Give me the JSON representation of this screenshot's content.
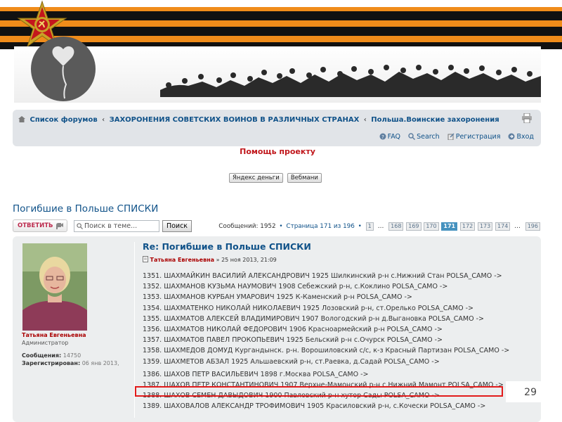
{
  "breadcrumb": {
    "items": [
      "Список форумов",
      "ЗАХОРОНЕНИЯ СОВЕТСКИХ ВОИНОВ В РАЗЛИЧНЫХ СТРАНАХ",
      "Польша.Воинские захоронения"
    ],
    "separator": "‹"
  },
  "nav": {
    "faq": "FAQ",
    "search": "Search",
    "register": "Регистрация",
    "login": "Вход"
  },
  "donate": {
    "title": "Помощь проекту",
    "buttons": [
      "Яндекс деньги",
      "Вебмани"
    ]
  },
  "topic": {
    "title": "Погибшие в Польше СПИСКИ",
    "reply_label": "ОТВЕТИТЬ",
    "search_placeholder": "Поиск в теме...",
    "search_button": "Поиск",
    "pagination": {
      "summary": "Сообщений: 1952",
      "page_info": "Страница 171 из 196",
      "pages": [
        "1",
        "168",
        "169",
        "170",
        "171",
        "172",
        "173",
        "174",
        "196"
      ],
      "current": "171"
    }
  },
  "post": {
    "author": {
      "name": "Татьяна Евгеньевна",
      "rank": "Администратор",
      "messages_label": "Сообщения:",
      "messages_value": "14750",
      "registered_label": "Зарегистрирован:",
      "registered_value": "06 янв 2013,"
    },
    "title": "Re: Погибшие в Польше СПИСКИ",
    "meta_author": "Татьяна Евгеньевна",
    "meta_date": "» 25 ноя 2013, 21:09",
    "lines": [
      "1351. ШАХМАЙКИН ВАСИЛИЙ АЛЕКСАНДРОВИЧ 1925 Шилкинский р-н с.Нижний Стан POLSA_CAMO ->",
      "1352. ШАХМАНОВ КУЗЬМА НАУМОВИЧ 1908 Себежский р-н, с.Коклино POLSA_CAMO ->",
      "1353. ШАХМАНОВ КУРБАН УМАРОВИЧ 1925 К-Каменский р-н POLSA_CAMO ->",
      "1354. ШАХМАТЕНКО НИКОЛАЙ НИКОЛАЕВИЧ 1925 Лозовский р-н, ст.Орелько POLSA_CAMO ->",
      "1355. ШАХМАТОВ АЛЕКСЕЙ ВЛАДИМИРОВИЧ 1907 Вологодский р-н д.Выгановка POLSA_CAMO ->",
      "1356. ШАХМАТОВ НИКОЛАЙ ФЕДОРОВИЧ 1906 Красноармейский р-н POLSA_CAMO ->",
      "1357. ШАХМАТОВ ПАВЕЛ ПРОКОПЬЕВИЧ 1925 Бельский р-н с.Очурск POLSA_CAMO ->",
      "1358. ШАХМЕДОВ ДОМУД Кургандынск. р-н. Ворошиловский с/с, к-з Красный Партизан POLSA_CAMO ->",
      "1359. ШАХМЕТОВ АБЗАЛ 1925 Альшаевский р-н, ст.Раевка, д.Садай POLSA_CAMO ->",
      "1386. ШАХОВ ПЕТР ВАСИЛЬЕВИЧ 1898 г.Москва POLSA_CAMO ->",
      "1387. ШАХОВ ПЕТР КОНСТАНТИНОВИЧ 1907 Верхне-Мамонский р-н с.Нижний Мамонт POLSA_CAMO ->",
      "1388. ШАХОВ СЕМЕН ДАВЫДОВИЧ 1900 Павловский р-н хутор Сады POLSA_CAMO ->",
      "1389. ШАХОВАЛОВ АЛЕКСАНДР ТРОФИМОВИЧ 1905 Красиловский р-н, с.Кочески POLSA_CAMO ->"
    ],
    "highlighted_index": 11
  },
  "slide_number": "29",
  "colors": {
    "link": "#105289",
    "accent_red": "#c0161b",
    "highlight_border": "#e21b1b",
    "panel_bg": "#e1e4e8"
  },
  "icons": [
    "home-icon",
    "print-icon",
    "faq-icon",
    "search-icon",
    "register-icon",
    "login-icon",
    "reply-icon",
    "magnifier-icon",
    "post-icon"
  ]
}
